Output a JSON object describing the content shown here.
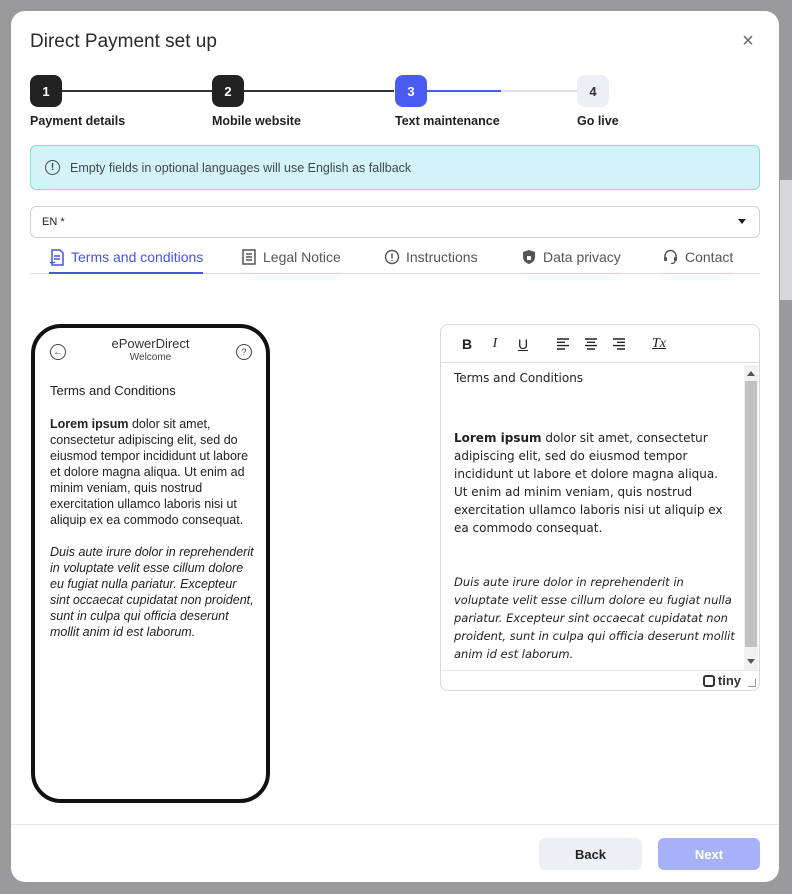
{
  "dialog": {
    "title": "Direct Payment set up",
    "close_glyph": "×"
  },
  "stepper": {
    "steps": [
      {
        "number": "1",
        "label": "Payment details",
        "state": "done"
      },
      {
        "number": "2",
        "label": "Mobile website",
        "state": "done"
      },
      {
        "number": "3",
        "label": "Text maintenance",
        "state": "active"
      },
      {
        "number": "4",
        "label": "Go live",
        "state": "pending"
      }
    ],
    "colors": {
      "done": "#222222",
      "active": "#4a5cf0",
      "pending": "#eeeef5"
    }
  },
  "info": {
    "icon": "info-icon",
    "text": "Empty fields in optional languages will use English as fallback",
    "icon_glyph": "!"
  },
  "language_select": {
    "value": "EN *"
  },
  "tabs": [
    {
      "label": "Terms and conditions",
      "icon": "document-signature-icon",
      "active": true
    },
    {
      "label": "Legal Notice",
      "icon": "newspaper-icon",
      "active": false
    },
    {
      "label": "Instructions",
      "icon": "info-circle-icon",
      "active": false
    },
    {
      "label": "Data privacy",
      "icon": "shield-lock-icon",
      "active": false
    },
    {
      "label": "Contact",
      "icon": "headset-icon",
      "active": false
    }
  ],
  "phone_preview": {
    "brand": "ePowerDirect",
    "subtitle": "Welcome",
    "heading": "Terms and Conditions",
    "bold_lead": "Lorem ipsum",
    "para1_rest": " dolor sit amet, consectetur adipiscing elit, sed do eiusmod tempor incididunt ut labore et dolore magna aliqua. Ut enim ad minim veniam, quis nostrud exercitation ullamco laboris nisi ut aliquip ex ea commodo consequat.",
    "para2": "Duis aute irure dolor in reprehenderit in voluptate velit esse cillum dolore eu fugiat nulla pariatur. Excepteur sint occaecat cupidatat non proident, sunt in culpa qui officia deserunt mollit anim id est laborum.",
    "back_glyph": "←",
    "chat_glyph": "?"
  },
  "editor": {
    "toolbar": {
      "bold": "B",
      "italic": "I",
      "underline": "U",
      "clear": "Tx"
    },
    "heading": "Terms and Conditions",
    "bold_lead": "Lorem ipsum",
    "para1_rest": " dolor sit amet, consectetur adipiscing elit, sed do eiusmod tempor incididunt ut labore et dolore magna aliqua. Ut enim ad minim veniam, quis nostrud exercitation ullamco laboris nisi ut aliquip ex ea commodo consequat.",
    "para2": "Duis aute irure dolor in reprehenderit in voluptate velit esse cillum dolore eu fugiat nulla pariatur. Excepteur sint occaecat cupidatat non proident, sunt in culpa qui officia deserunt mollit anim id est laborum.",
    "brand": "tiny"
  },
  "footer": {
    "back_label": "Back",
    "next_label": "Next"
  },
  "colors": {
    "accent": "#4556d6",
    "info_bg": "#d5f2f6",
    "next_disabled": "#a7b1f7",
    "tab_underline_inactive": "#f3c9d2"
  }
}
